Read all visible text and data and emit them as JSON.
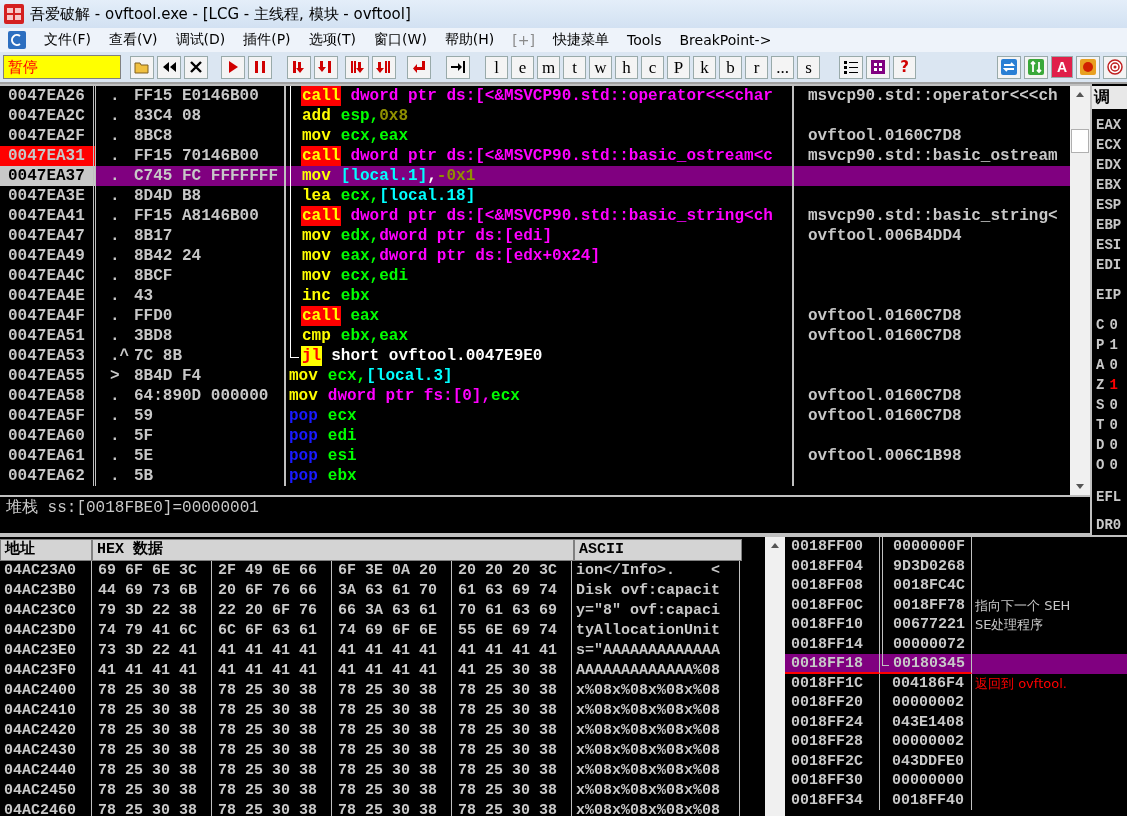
{
  "window": {
    "title": "吾爱破解 - ovftool.exe - [LCG - 主线程, 模块 - ovftool]"
  },
  "menu": [
    {
      "label": "文件(F)",
      "disabled": false
    },
    {
      "label": "查看(V)",
      "disabled": false
    },
    {
      "label": "调试(D)",
      "disabled": false
    },
    {
      "label": "插件(P)",
      "disabled": false
    },
    {
      "label": "选项(T)",
      "disabled": false
    },
    {
      "label": "窗口(W)",
      "disabled": false
    },
    {
      "label": "帮助(H)",
      "disabled": false
    },
    {
      "label": "[+]",
      "disabled": true
    },
    {
      "label": "快捷菜单",
      "disabled": false
    },
    {
      "label": "Tools",
      "disabled": false
    },
    {
      "label": "BreakPoint->",
      "disabled": false
    }
  ],
  "toolbar": {
    "status": "暂停",
    "letter_buttons": [
      "l",
      "e",
      "m",
      "t",
      "w",
      "h",
      "c",
      "P",
      "k",
      "b",
      "r",
      "...",
      "s"
    ],
    "help_button": "?",
    "font_button": "A"
  },
  "disassembly": [
    {
      "address": "0047EA26",
      "mark": ".",
      "hex": "FF15 E0146B00",
      "mnemonic": {
        "kind": "call",
        "text": "call"
      },
      "loop_line": true,
      "loop_end": false,
      "operands": [
        {
          "kind": "mem",
          "text": "dword ptr ds:[<&MSVCP90.std::operator<<<char"
        }
      ],
      "comment": "msvcp90.std::operator<<<ch",
      "breakpoint": false,
      "selected": false
    },
    {
      "address": "0047EA2C",
      "mark": ".",
      "hex": "83C4 08",
      "mnemonic": {
        "kind": "plain",
        "text": "add"
      },
      "loop_line": true,
      "loop_end": false,
      "operands": [
        {
          "kind": "reg",
          "text": "esp,"
        },
        {
          "kind": "imm",
          "text": "0x8"
        }
      ],
      "breakpoint": false,
      "selected": false
    },
    {
      "address": "0047EA2F",
      "mark": ".",
      "hex": "8BC8",
      "mnemonic": {
        "kind": "plain",
        "text": "mov"
      },
      "loop_line": true,
      "loop_end": false,
      "operands": [
        {
          "kind": "reg",
          "text": "ecx,eax"
        }
      ],
      "comment": "ovftool.0160C7D8",
      "breakpoint": false,
      "selected": false
    },
    {
      "address": "0047EA31",
      "mark": ".",
      "hex": "FF15 70146B00",
      "mnemonic": {
        "kind": "call",
        "text": "call"
      },
      "loop_line": true,
      "loop_end": false,
      "operands": [
        {
          "kind": "mem",
          "text": "dword ptr ds:[<&MSVCP90.std::basic_ostream<c"
        }
      ],
      "comment": "msvcp90.std::basic_ostream",
      "breakpoint": true,
      "selected": false
    },
    {
      "address": "0047EA37",
      "mark": ".",
      "hex": "C745 FC FFFFFFF",
      "mnemonic": {
        "kind": "plain",
        "text": "mov"
      },
      "loop_line": true,
      "loop_end": false,
      "operands": [
        {
          "kind": "local",
          "text": "[local.1]"
        },
        {
          "kind": "text",
          "text": ","
        },
        {
          "kind": "imm",
          "text": "-0x1"
        }
      ],
      "breakpoint": false,
      "selected": true
    },
    {
      "address": "0047EA3E",
      "mark": ".",
      "hex": "8D4D B8",
      "mnemonic": {
        "kind": "plain",
        "text": "lea"
      },
      "loop_line": true,
      "loop_end": false,
      "operands": [
        {
          "kind": "reg",
          "text": "ecx,"
        },
        {
          "kind": "local",
          "text": "[local.18]"
        }
      ],
      "breakpoint": false,
      "selected": false
    },
    {
      "address": "0047EA41",
      "mark": ".",
      "hex": "FF15 A8146B00",
      "mnemonic": {
        "kind": "call",
        "text": "call"
      },
      "loop_line": true,
      "loop_end": false,
      "operands": [
        {
          "kind": "mem",
          "text": "dword ptr ds:[<&MSVCP90.std::basic_string<ch"
        }
      ],
      "comment": "msvcp90.std::basic_string<",
      "breakpoint": false,
      "selected": false
    },
    {
      "address": "0047EA47",
      "mark": ".",
      "hex": "8B17",
      "mnemonic": {
        "kind": "plain",
        "text": "mov"
      },
      "loop_line": true,
      "loop_end": false,
      "operands": [
        {
          "kind": "reg",
          "text": "edx,"
        },
        {
          "kind": "mem",
          "text": "dword ptr ds:[edi]"
        }
      ],
      "comment": "ovftool.006B4DD4",
      "breakpoint": false,
      "selected": false
    },
    {
      "address": "0047EA49",
      "mark": ".",
      "hex": "8B42 24",
      "mnemonic": {
        "kind": "plain",
        "text": "mov"
      },
      "loop_line": true,
      "loop_end": false,
      "operands": [
        {
          "kind": "reg",
          "text": "eax,"
        },
        {
          "kind": "mem",
          "text": "dword ptr ds:[edx+0x24]"
        }
      ],
      "breakpoint": false,
      "selected": false
    },
    {
      "address": "0047EA4C",
      "mark": ".",
      "hex": "8BCF",
      "mnemonic": {
        "kind": "plain",
        "text": "mov"
      },
      "loop_line": true,
      "loop_end": false,
      "operands": [
        {
          "kind": "reg",
          "text": "ecx,edi"
        }
      ],
      "breakpoint": false,
      "selected": false
    },
    {
      "address": "0047EA4E",
      "mark": ".",
      "hex": "43",
      "mnemonic": {
        "kind": "plain",
        "text": "inc"
      },
      "loop_line": true,
      "loop_end": false,
      "operands": [
        {
          "kind": "reg",
          "text": "ebx"
        }
      ],
      "breakpoint": false,
      "selected": false
    },
    {
      "address": "0047EA4F",
      "mark": ".",
      "hex": "FFD0",
      "mnemonic": {
        "kind": "call",
        "text": "call"
      },
      "loop_line": true,
      "loop_end": false,
      "operands": [
        {
          "kind": "reg",
          "text": "eax"
        }
      ],
      "comment": "ovftool.0160C7D8",
      "breakpoint": false,
      "selected": false
    },
    {
      "address": "0047EA51",
      "mark": ".",
      "hex": "3BD8",
      "mnemonic": {
        "kind": "plain",
        "text": "cmp"
      },
      "loop_line": true,
      "loop_end": false,
      "operands": [
        {
          "kind": "reg",
          "text": "ebx,eax"
        }
      ],
      "comment": "ovftool.0160C7D8",
      "breakpoint": false,
      "selected": false
    },
    {
      "address": "0047EA53",
      "mark": ".^",
      "hex": "7C 8B",
      "mnemonic": {
        "kind": "jump",
        "text": "jl"
      },
      "loop_line": true,
      "loop_end": true,
      "operands": [
        {
          "kind": "text",
          "text": "short ovftool.0047E9E0"
        }
      ],
      "breakpoint": false,
      "selected": false
    },
    {
      "address": "0047EA55",
      "mark": ">",
      "hex": "8B4D F4",
      "mnemonic": {
        "kind": "plain",
        "text": "mov"
      },
      "loop_line": false,
      "loop_end": false,
      "operands": [
        {
          "kind": "reg",
          "text": "ecx,"
        },
        {
          "kind": "local",
          "text": "[local.3]"
        }
      ],
      "breakpoint": false,
      "selected": false
    },
    {
      "address": "0047EA58",
      "mark": ".",
      "hex": "64:890D 000000",
      "mnemonic": {
        "kind": "plain",
        "text": "mov"
      },
      "loop_line": false,
      "loop_end": false,
      "operands": [
        {
          "kind": "mem",
          "text": "dword ptr fs:[0],"
        },
        {
          "kind": "reg",
          "text": "ecx"
        }
      ],
      "comment": "ovftool.0160C7D8",
      "breakpoint": false,
      "selected": false
    },
    {
      "address": "0047EA5F",
      "mark": ".",
      "hex": "59",
      "mnemonic": {
        "kind": "pop",
        "text": "pop"
      },
      "loop_line": false,
      "loop_end": false,
      "operands": [
        {
          "kind": "reg",
          "text": "ecx"
        }
      ],
      "comment": "ovftool.0160C7D8",
      "breakpoint": false,
      "selected": false
    },
    {
      "address": "0047EA60",
      "mark": ".",
      "hex": "5F",
      "mnemonic": {
        "kind": "pop",
        "text": "pop"
      },
      "loop_line": false,
      "loop_end": false,
      "operands": [
        {
          "kind": "reg",
          "text": "edi"
        }
      ],
      "breakpoint": false,
      "selected": false
    },
    {
      "address": "0047EA61",
      "mark": ".",
      "hex": "5E",
      "mnemonic": {
        "kind": "pop",
        "text": "pop"
      },
      "loop_line": false,
      "loop_end": false,
      "operands": [
        {
          "kind": "reg",
          "text": "esi"
        }
      ],
      "comment": "ovftool.006C1B98",
      "breakpoint": false,
      "selected": false
    },
    {
      "address": "0047EA62",
      "mark": ".",
      "hex": "5B",
      "mnemonic": {
        "kind": "pop",
        "text": "pop"
      },
      "loop_line": false,
      "loop_end": false,
      "operands": [
        {
          "kind": "reg",
          "text": "ebx"
        }
      ],
      "breakpoint": false,
      "selected": false
    }
  ],
  "info_line": "堆栈 ss:[0018FBE0]=00000001",
  "registers": {
    "title": "调",
    "general": [
      "EAX",
      "ECX",
      "EDX",
      "EBX",
      "ESP",
      "EBP",
      "ESI",
      "EDI"
    ],
    "eip": "EIP",
    "flags": [
      {
        "name": "C",
        "value": "0",
        "changed": false
      },
      {
        "name": "P",
        "value": "1",
        "changed": false
      },
      {
        "name": "A",
        "value": "0",
        "changed": false
      },
      {
        "name": "Z",
        "value": "1",
        "changed": true
      },
      {
        "name": "S",
        "value": "0",
        "changed": false
      },
      {
        "name": "T",
        "value": "0",
        "changed": false
      },
      {
        "name": "D",
        "value": "0",
        "changed": false
      },
      {
        "name": "O",
        "value": "0",
        "changed": false
      }
    ],
    "efl": "EFL",
    "debug": "DR0"
  },
  "dump": {
    "columns": [
      "地址",
      "HEX 数据",
      "ASCII"
    ],
    "rows": [
      {
        "address": "04AC23A0",
        "groups": [
          "69 6F 6E 3C",
          "2F 49 6E 66",
          "6F 3E 0A 20",
          "20 20 20 3C"
        ],
        "ascii": "ion</Info>.    <"
      },
      {
        "address": "04AC23B0",
        "groups": [
          "44 69 73 6B",
          "20 6F 76 66",
          "3A 63 61 70",
          "61 63 69 74"
        ],
        "ascii": "Disk ovf:capacit"
      },
      {
        "address": "04AC23C0",
        "groups": [
          "79 3D 22 38",
          "22 20 6F 76",
          "66 3A 63 61",
          "70 61 63 69"
        ],
        "ascii": "y=\"8\" ovf:capaci"
      },
      {
        "address": "04AC23D0",
        "groups": [
          "74 79 41 6C",
          "6C 6F 63 61",
          "74 69 6F 6E",
          "55 6E 69 74"
        ],
        "ascii": "tyAllocationUnit"
      },
      {
        "address": "04AC23E0",
        "groups": [
          "73 3D 22 41",
          "41 41 41 41",
          "41 41 41 41",
          "41 41 41 41"
        ],
        "ascii": "s=\"AAAAAAAAAAAAA"
      },
      {
        "address": "04AC23F0",
        "groups": [
          "41 41 41 41",
          "41 41 41 41",
          "41 41 41 41",
          "41 25 30 38"
        ],
        "ascii": "AAAAAAAAAAAAA%08"
      },
      {
        "address": "04AC2400",
        "groups": [
          "78 25 30 38",
          "78 25 30 38",
          "78 25 30 38",
          "78 25 30 38"
        ],
        "ascii": "x%08x%08x%08x%08"
      },
      {
        "address": "04AC2410",
        "groups": [
          "78 25 30 38",
          "78 25 30 38",
          "78 25 30 38",
          "78 25 30 38"
        ],
        "ascii": "x%08x%08x%08x%08"
      },
      {
        "address": "04AC2420",
        "groups": [
          "78 25 30 38",
          "78 25 30 38",
          "78 25 30 38",
          "78 25 30 38"
        ],
        "ascii": "x%08x%08x%08x%08"
      },
      {
        "address": "04AC2430",
        "groups": [
          "78 25 30 38",
          "78 25 30 38",
          "78 25 30 38",
          "78 25 30 38"
        ],
        "ascii": "x%08x%08x%08x%08"
      },
      {
        "address": "04AC2440",
        "groups": [
          "78 25 30 38",
          "78 25 30 38",
          "78 25 30 38",
          "78 25 30 38"
        ],
        "ascii": "x%08x%08x%08x%08"
      },
      {
        "address": "04AC2450",
        "groups": [
          "78 25 30 38",
          "78 25 30 38",
          "78 25 30 38",
          "78 25 30 38"
        ],
        "ascii": "x%08x%08x%08x%08"
      },
      {
        "address": "04AC2460",
        "groups": [
          "78 25 30 38",
          "78 25 30 38",
          "78 25 30 38",
          "78 25 30 38"
        ],
        "ascii": "x%08x%08x%08x%08"
      }
    ]
  },
  "stack": [
    {
      "address": "0018FF00",
      "value": "0000000F",
      "chain_line": true,
      "chain_end": false,
      "selected": false,
      "underlined": false
    },
    {
      "address": "0018FF04",
      "value": "9D3D0268",
      "chain_line": true,
      "chain_end": false,
      "selected": false,
      "underlined": false
    },
    {
      "address": "0018FF08",
      "value": "0018FC4C",
      "chain_line": true,
      "chain_end": false,
      "selected": false,
      "underlined": false
    },
    {
      "address": "0018FF0C",
      "value": "0018FF78",
      "chain_line": true,
      "chain_end": false,
      "comment": {
        "kind": "plain",
        "text": "指向下一个 SEH"
      },
      "selected": false,
      "underlined": false
    },
    {
      "address": "0018FF10",
      "value": "00677221",
      "chain_line": true,
      "chain_end": false,
      "comment": {
        "kind": "plain",
        "text": "SE处理程序"
      },
      "selected": false,
      "underlined": false
    },
    {
      "address": "0018FF14",
      "value": "00000072",
      "chain_line": true,
      "chain_end": false,
      "selected": false,
      "underlined": false
    },
    {
      "address": "0018FF18",
      "value": "00180345",
      "chain_line": true,
      "chain_end": true,
      "selected": true,
      "underlined": true
    },
    {
      "address": "0018FF1C",
      "value": "004186F4",
      "chain_line": false,
      "chain_end": false,
      "comment": {
        "kind": "return",
        "text": "返回到 ovftool."
      },
      "selected": false,
      "underlined": false
    },
    {
      "address": "0018FF20",
      "value": "00000002",
      "chain_line": false,
      "chain_end": false,
      "selected": false,
      "underlined": false
    },
    {
      "address": "0018FF24",
      "value": "043E1408",
      "chain_line": false,
      "chain_end": false,
      "selected": false,
      "underlined": false
    },
    {
      "address": "0018FF28",
      "value": "00000002",
      "chain_line": false,
      "chain_end": false,
      "selected": false,
      "underlined": false
    },
    {
      "address": "0018FF2C",
      "value": "043DDFE0",
      "chain_line": false,
      "chain_end": false,
      "selected": false,
      "underlined": false
    },
    {
      "address": "0018FF30",
      "value": "00000000",
      "chain_line": false,
      "chain_end": false,
      "selected": false,
      "underlined": false
    },
    {
      "address": "0018FF34",
      "value": "0018FF40",
      "chain_line": false,
      "chain_end": false,
      "selected": false,
      "underlined": false
    }
  ]
}
